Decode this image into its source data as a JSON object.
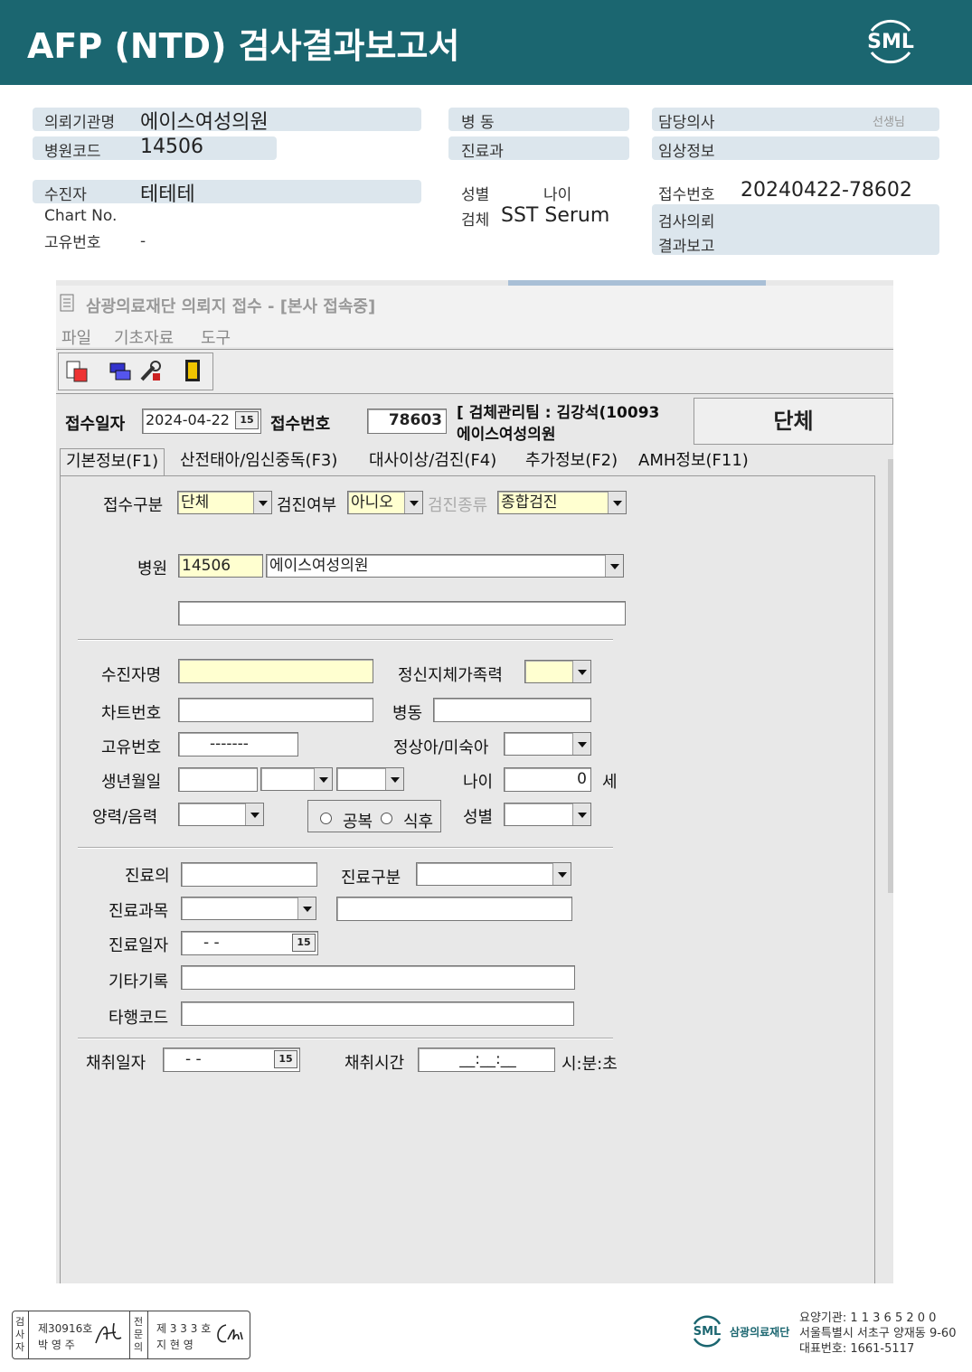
{
  "header": {
    "title": "AFP  (NTD) 검사결과보고서",
    "logo": "SML"
  },
  "report": {
    "inst_label": "의뢰기관명",
    "inst_value": "에이스여성의원",
    "code_label": "병원코드",
    "code_value": "14506",
    "ward_label": "병   동",
    "dept_label": "진료과",
    "doctor_label": "담당의사",
    "doctor_suffix": "선생님",
    "clinical_label": "임상정보",
    "patient_label": "수진자",
    "patient_value": "테테테",
    "chart_label": "Chart No.",
    "id_label": "고유번호",
    "id_value": "-",
    "sex_label": "성별",
    "age_label": "나이",
    "specimen_label": "검체",
    "specimen_value": "SST Serum",
    "accession_label": "접수번호",
    "accession_value": "20240422-78602",
    "request_label": "검사의뢰",
    "result_label": "결과보고"
  },
  "app": {
    "title": "삼광의료재단 의뢰지 접수 - [본사 접속중]",
    "menu": [
      "파일",
      "기초자료",
      "도구"
    ],
    "receipt_date_label": "접수일자",
    "receipt_date": "2024-04-22",
    "receipt_no_label": "접수번호",
    "receipt_no": "78603",
    "team_line1": "[ 검체관리팀 : 김강석(10093",
    "team_line2": "에이스여성의원",
    "group_button": "단체",
    "tabs": [
      "기본정보(F1)",
      "산전태아/임신중독(F3)",
      "대사이상/검진(F4)",
      "추가정보(F2)",
      "AMH정보(F11)"
    ],
    "form": {
      "receipt_type_label": "접수구분",
      "receipt_type": "단체",
      "checkup_label": "검진여부",
      "checkup": "아니오",
      "checkup_kind_label": "검진종류",
      "checkup_kind": "종합검진",
      "hospital_label": "병원",
      "hospital_code": "14506",
      "hospital_name": "에이스여성의원",
      "patient_name_label": "수진자명",
      "disability_label": "정신지체가족력",
      "chart_no_label": "차트번호",
      "ward_label": "병동",
      "unique_no_label": "고유번호",
      "unique_no": "-------",
      "normal_label": "정상아/미숙아",
      "birth_label": "생년월일",
      "age_label": "나이",
      "age_value": "0",
      "age_unit": "세",
      "calendar_label": "양력/음력",
      "fasting": "공복",
      "after_meal": "식후",
      "sex_label": "성별",
      "doctor_label": "진료의",
      "dept_type_label": "진료구분",
      "dept_label": "진료과목",
      "visit_date_label": "진료일자",
      "visit_date": "-  -",
      "etc_label": "기타기록",
      "other_code_label": "타행코드",
      "collect_date_label": "채취일자",
      "collect_date": "-  -",
      "collect_time_label": "채취시간",
      "collect_time": "__:__:__",
      "time_unit": "시:분:초"
    }
  },
  "footer": {
    "tester_label": "검사자",
    "tester_no": "제30916호",
    "tester_name": "박  영  주",
    "specialist_label": "전문의",
    "specialist_no": "제 3 3 3 호",
    "specialist_name": "지  현  영",
    "foundation": "삼광의료재단",
    "care_no": "요양기관: 1 1 3 6 5 2 0 0",
    "address": "서울특별시 서초구 양재동 9-60",
    "phone": "대표번호: 1661-5117"
  }
}
